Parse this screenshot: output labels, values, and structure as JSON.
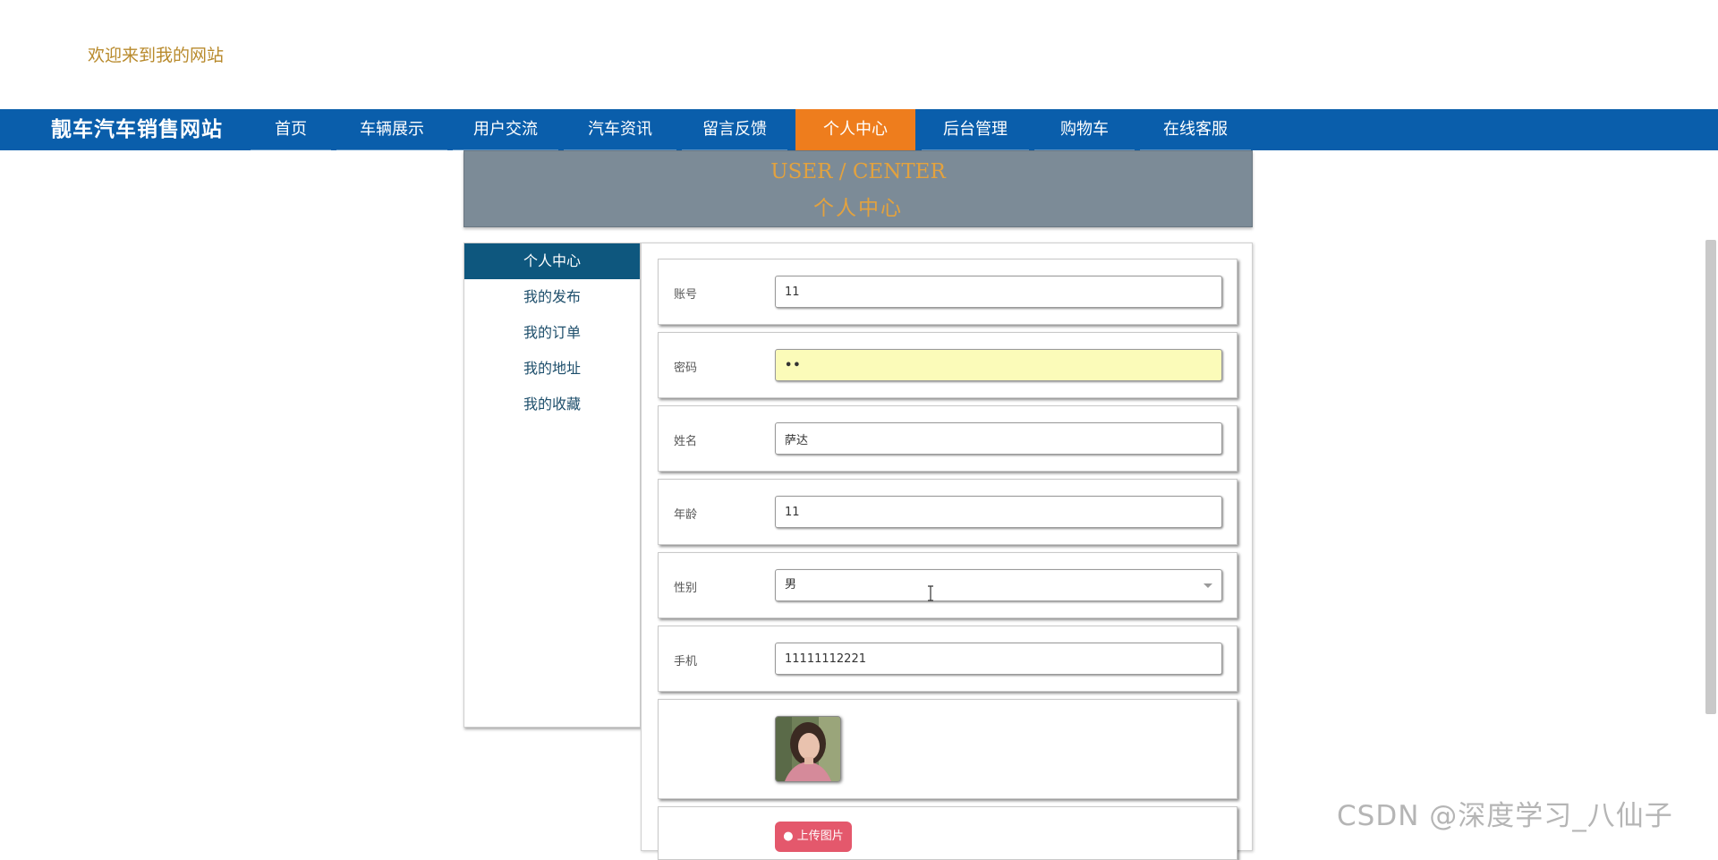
{
  "header": {
    "welcome_text": "欢迎来到我的网站"
  },
  "nav": {
    "brand": "靓车汽车销售网站",
    "items": [
      {
        "label": "首页"
      },
      {
        "label": "车辆展示"
      },
      {
        "label": "用户交流"
      },
      {
        "label": "汽车资讯"
      },
      {
        "label": "留言反馈"
      },
      {
        "label": "个人中心",
        "active": true
      },
      {
        "label": "后台管理"
      },
      {
        "label": "购物车"
      },
      {
        "label": "在线客服"
      }
    ]
  },
  "banner": {
    "title_en": "USER / CENTER",
    "title_cn": "个人中心"
  },
  "side_menu": {
    "items": [
      {
        "label": "个人中心",
        "active": true
      },
      {
        "label": "我的发布"
      },
      {
        "label": "我的订单"
      },
      {
        "label": "我的地址"
      },
      {
        "label": "我的收藏"
      }
    ]
  },
  "form": {
    "account": {
      "label": "账号",
      "value": "11"
    },
    "password": {
      "label": "密码",
      "value": "••"
    },
    "name": {
      "label": "姓名",
      "value": "萨达"
    },
    "age": {
      "label": "年龄",
      "value": "11"
    },
    "gender": {
      "label": "性别",
      "value": "男"
    },
    "phone": {
      "label": "手机",
      "value": "11111112221"
    },
    "upload_label": "上传图片"
  },
  "watermark": "CSDN @深度学习_八仙子",
  "colors": {
    "nav_bg": "#0a5eab",
    "nav_active": "#ee7d1d",
    "banner_bg": "#7c8b97",
    "banner_text": "#e3a23e",
    "side_active": "#0e577e",
    "password_fill": "#fbfbb9",
    "upload_button": "#e4586c"
  }
}
